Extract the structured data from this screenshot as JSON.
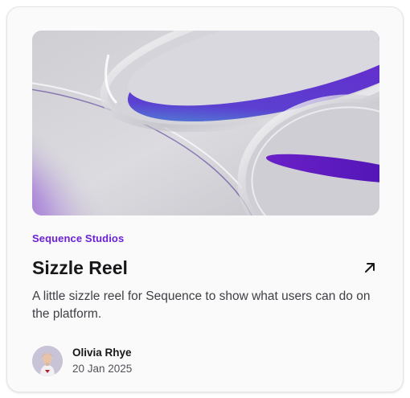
{
  "card": {
    "category": "Sequence Studios",
    "title": "Sizzle Reel",
    "description": "A little sizzle reel for Sequence to show what users can do on the platform.",
    "author": {
      "name": "Olivia Rhye",
      "date": "20 Jan 2025"
    },
    "link_icon": "arrow-up-right-icon"
  },
  "colors": {
    "accent": "#6b21d6",
    "title": "#18181b",
    "body": "#3f3f46",
    "card_bg": "#fafafa",
    "border": "#e4e4e7"
  }
}
